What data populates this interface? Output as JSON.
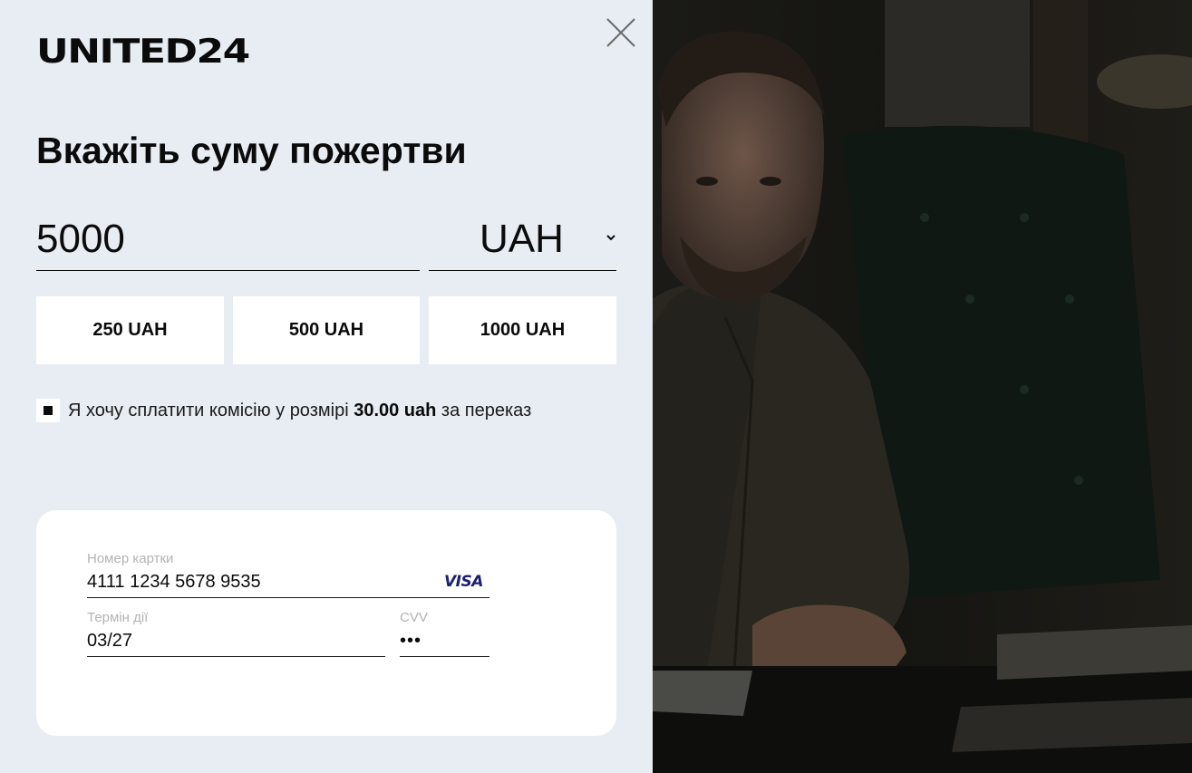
{
  "brand": {
    "logo_text": "UNITED24"
  },
  "form": {
    "heading": "Вкажіть суму пожертви",
    "amount": "5000",
    "currency": "UAH",
    "presets": [
      "250 UAH",
      "500 UAH",
      "1000 UAH"
    ],
    "fee": {
      "checked": true,
      "text_before": "Я хочу сплатити комісію у розмірі ",
      "amount": "30.00 uah",
      "text_after": " за переказ"
    }
  },
  "card": {
    "number_label": "Номер картки",
    "number": "4111 1234 5678 9535",
    "brand": "VISA",
    "expiry_label": "Термін дії",
    "expiry": "03/27",
    "cvv_label": "CVV",
    "cvv": "•••"
  },
  "icons": {
    "close": "close-icon",
    "currency_dropdown": "chevron-down-icon",
    "checkbox": "checkbox-checked-icon"
  },
  "colors": {
    "panel_bg": "#e8edf3",
    "text": "#0b0b0b",
    "card_bg": "#ffffff",
    "visa": "#1a1f71",
    "label": "#b3b3b3"
  }
}
